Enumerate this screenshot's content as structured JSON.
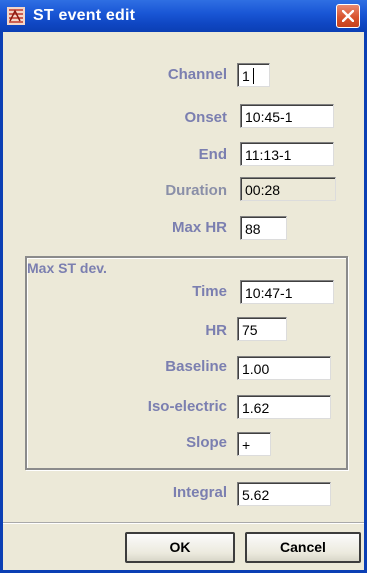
{
  "window": {
    "title": "ST event edit",
    "icon": "app-logo-icon",
    "close_icon": "close-icon"
  },
  "fields": {
    "channel": {
      "label": "Channel",
      "value": "1"
    },
    "onset": {
      "label": "Onset",
      "value": "10:45-1"
    },
    "end": {
      "label": "End",
      "value": "11:13-1"
    },
    "duration": {
      "label": "Duration",
      "value": "00:28"
    },
    "max_hr": {
      "label": "Max HR",
      "value": "88"
    }
  },
  "max_st_dev": {
    "title": "Max ST dev.",
    "time": {
      "label": "Time",
      "value": "10:47-1"
    },
    "hr": {
      "label": "HR",
      "value": "75"
    },
    "baseline": {
      "label": "Baseline",
      "value": "1.00"
    },
    "iso_electric": {
      "label": "Iso-electric",
      "value": "1.62"
    },
    "slope": {
      "label": "Slope",
      "value": "+"
    }
  },
  "integral": {
    "label": "Integral",
    "value": "5.62"
  },
  "buttons": {
    "ok": "OK",
    "cancel": "Cancel"
  },
  "colors": {
    "title_bar": "#1a57d6",
    "label": "#7b7fb0",
    "close_button": "#d9542f",
    "background": "#ece9d8"
  }
}
